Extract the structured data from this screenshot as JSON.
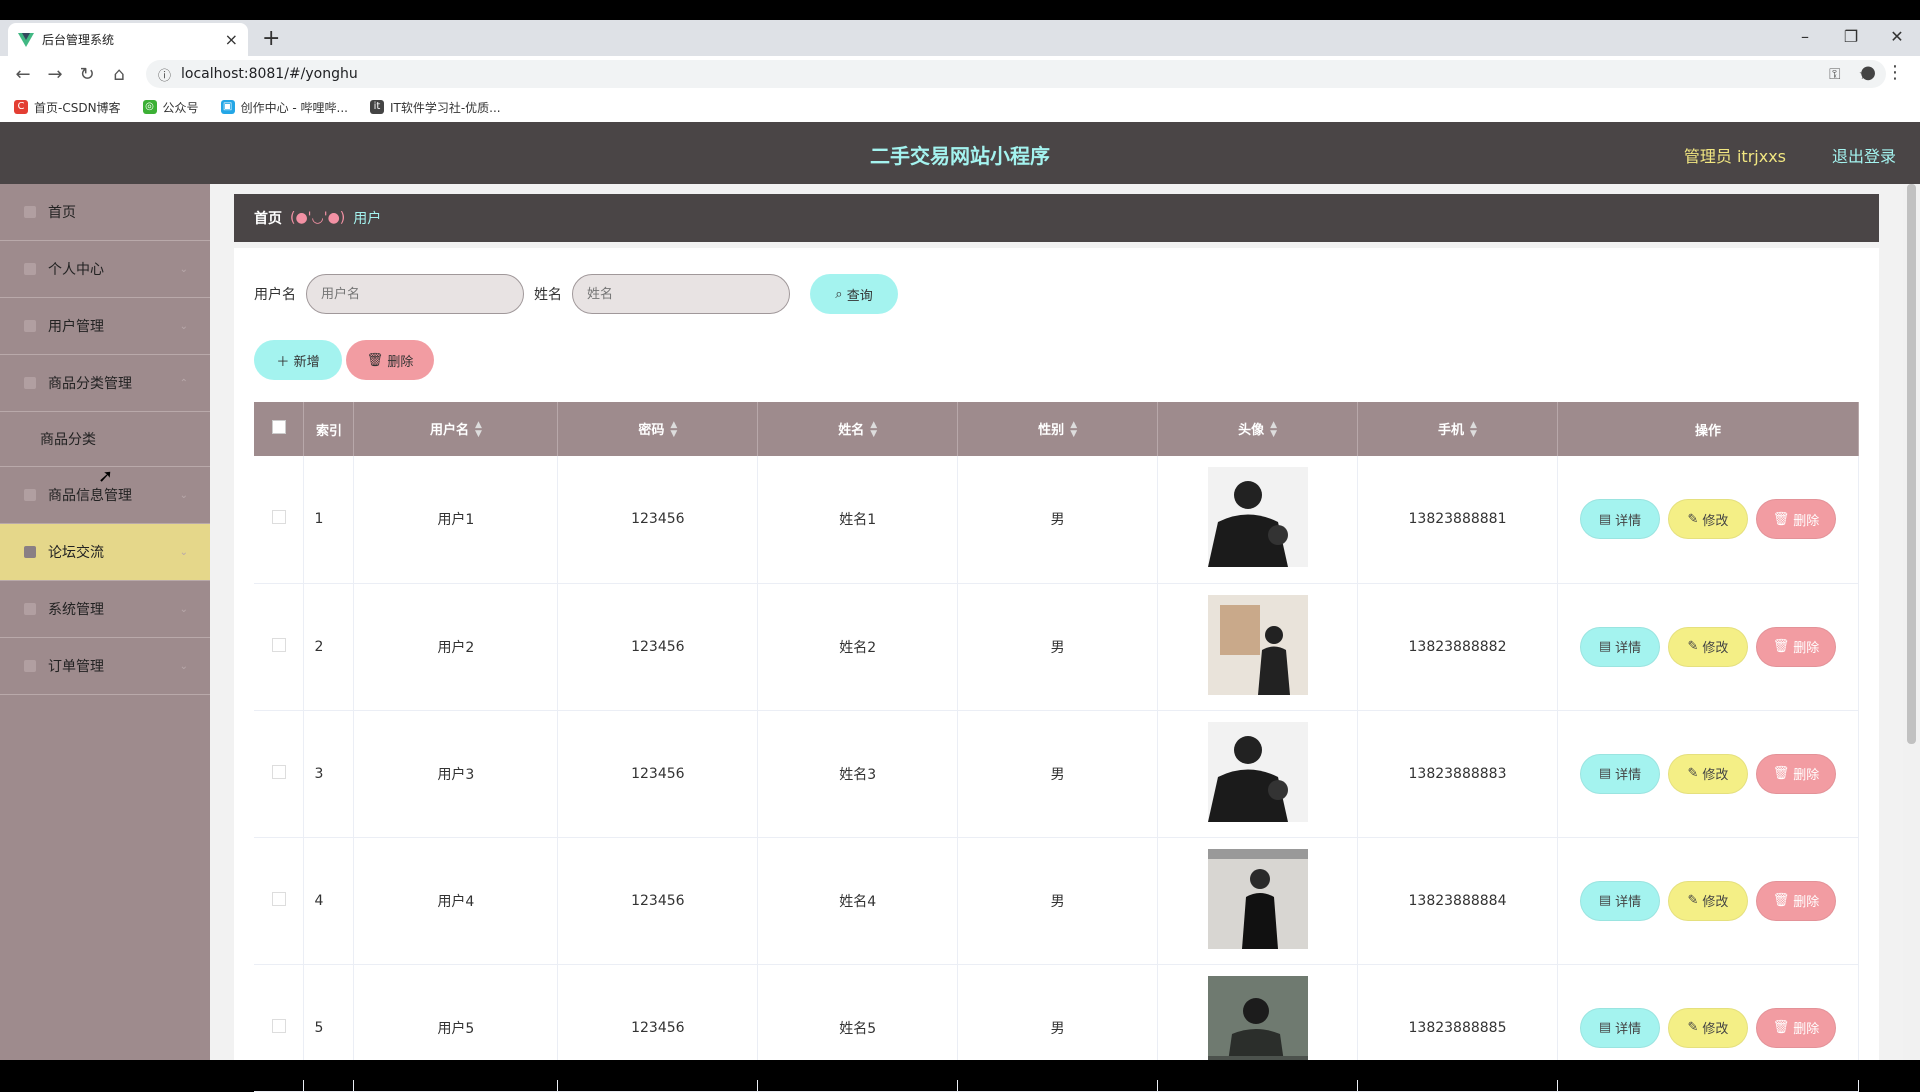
{
  "browser": {
    "tab_title": "后台管理系统",
    "url": "localhost:8081/#/yonghu",
    "bookmarks": [
      "首页-CSDN博客",
      "公众号",
      "创作中心 - 哔哩哔...",
      "IT软件学习社-优质..."
    ]
  },
  "header": {
    "title": "二手交易网站小程序",
    "admin_label": "管理员 itrjxxs",
    "logout_label": "退出登录"
  },
  "sidebar": {
    "items": [
      {
        "label": "首页"
      },
      {
        "label": "个人中心"
      },
      {
        "label": "用户管理"
      },
      {
        "label": "商品分类管理"
      },
      {
        "label": "商品分类"
      },
      {
        "label": "商品信息管理"
      },
      {
        "label": "论坛交流"
      },
      {
        "label": "系统管理"
      },
      {
        "label": "订单管理"
      }
    ]
  },
  "breadcrumb": {
    "home": "首页",
    "separator": "(●'◡'●)",
    "current": "用户"
  },
  "search": {
    "username_label": "用户名",
    "username_placeholder": "用户名",
    "name_label": "姓名",
    "name_placeholder": "姓名",
    "query_label": "查询"
  },
  "actions": {
    "add_label": "新增",
    "delete_label": "删除"
  },
  "table": {
    "headers": [
      "索引",
      "用户名",
      "密码",
      "姓名",
      "性别",
      "头像",
      "手机",
      "操作"
    ],
    "rows": [
      {
        "index": "1",
        "username": "用户1",
        "password": "123456",
        "name": "姓名1",
        "gender": "男",
        "phone": "13823888881"
      },
      {
        "index": "2",
        "username": "用户2",
        "password": "123456",
        "name": "姓名2",
        "gender": "男",
        "phone": "13823888882"
      },
      {
        "index": "3",
        "username": "用户3",
        "password": "123456",
        "name": "姓名3",
        "gender": "男",
        "phone": "13823888883"
      },
      {
        "index": "4",
        "username": "用户4",
        "password": "123456",
        "name": "姓名4",
        "gender": "男",
        "phone": "13823888884"
      },
      {
        "index": "5",
        "username": "用户5",
        "password": "123456",
        "name": "姓名5",
        "gender": "男",
        "phone": "13823888885"
      }
    ],
    "op_detail": "详情",
    "op_edit": "修改",
    "op_delete": "删除"
  },
  "colors": {
    "header_bg": "#4a4546",
    "accent_cyan": "#a4f3ef",
    "accent_yellow": "#f4ef86",
    "accent_pink": "#f29ca2",
    "sidebar_bg": "#9e8b8d",
    "sidebar_active": "#e5d78a"
  }
}
